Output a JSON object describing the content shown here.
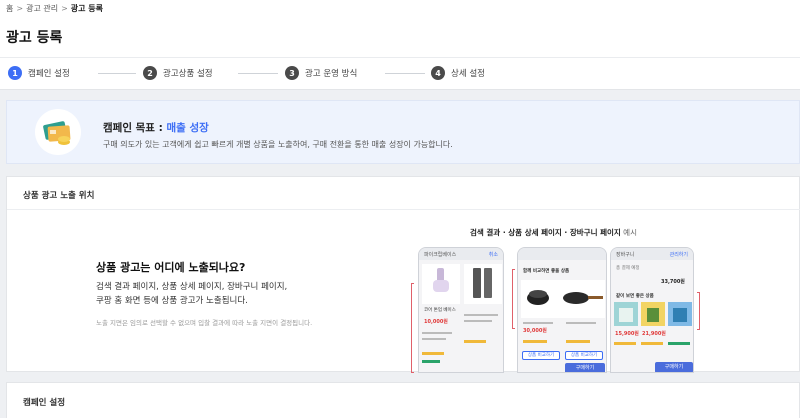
{
  "breadcrumb": {
    "home": "홈",
    "ads": "광고 관리",
    "current": "광고 등록",
    "sep": ">"
  },
  "page_title": "광고 등록",
  "steps": [
    {
      "num": "1",
      "label": "캠페인 설정"
    },
    {
      "num": "2",
      "label": "광고상품 설정"
    },
    {
      "num": "3",
      "label": "광고 운영 방식"
    },
    {
      "num": "4",
      "label": "상세 설정"
    }
  ],
  "goal": {
    "title_prefix": "캠페인 목표 : ",
    "title_value": "매출 성장",
    "description": "구매 의도가 있는 고객에게 쉽고 빠르게 개별 상품을 노출하여, 구매 전환을 통한 매출 성장이 가능합니다."
  },
  "placement": {
    "header": "상품 광고 노출 위치",
    "question": "상품 광고는 어디에 노출되나요?",
    "desc_line1": "검색 결과 페이지, 상품 상세 페이지, 장바구니 페이지,",
    "desc_line2": "쿠팡 홈 화면 등에 상품 광고가 노출됩니다.",
    "note": "노출 지면은 임의로 선택할 수 없으며 입찰 결과에 따라 노출 지면이 결정됩니다.",
    "caption": "검색 결과 · 상품 상세 페이지 · 장바구니 페이지",
    "caption_suffix": " 예시",
    "phone1": {
      "search": "파이크립베이스",
      "right": "취소",
      "price": "10,000원",
      "item": "코어 톤업 베이스"
    },
    "phone2": {
      "title": "함께 비교하면 좋을 상품",
      "btn1": "상품 비교하기",
      "btn2": "상품 비교하기",
      "buy": "구매하기",
      "price": "30,000원"
    },
    "phone3": {
      "title": "장바구니",
      "right": "관리하기",
      "total_label": "총 결제 예정",
      "total": "33,700원",
      "rec": "같이 보면 좋은 상품",
      "price": "15,900원",
      "price2": "21,900원",
      "buy": "구매하기"
    }
  },
  "campaign": {
    "header": "캠페인 설정"
  },
  "colors": {
    "accent": "#3d6ef5",
    "price_red": "#e03a3a",
    "bracket": "#e0606a"
  }
}
